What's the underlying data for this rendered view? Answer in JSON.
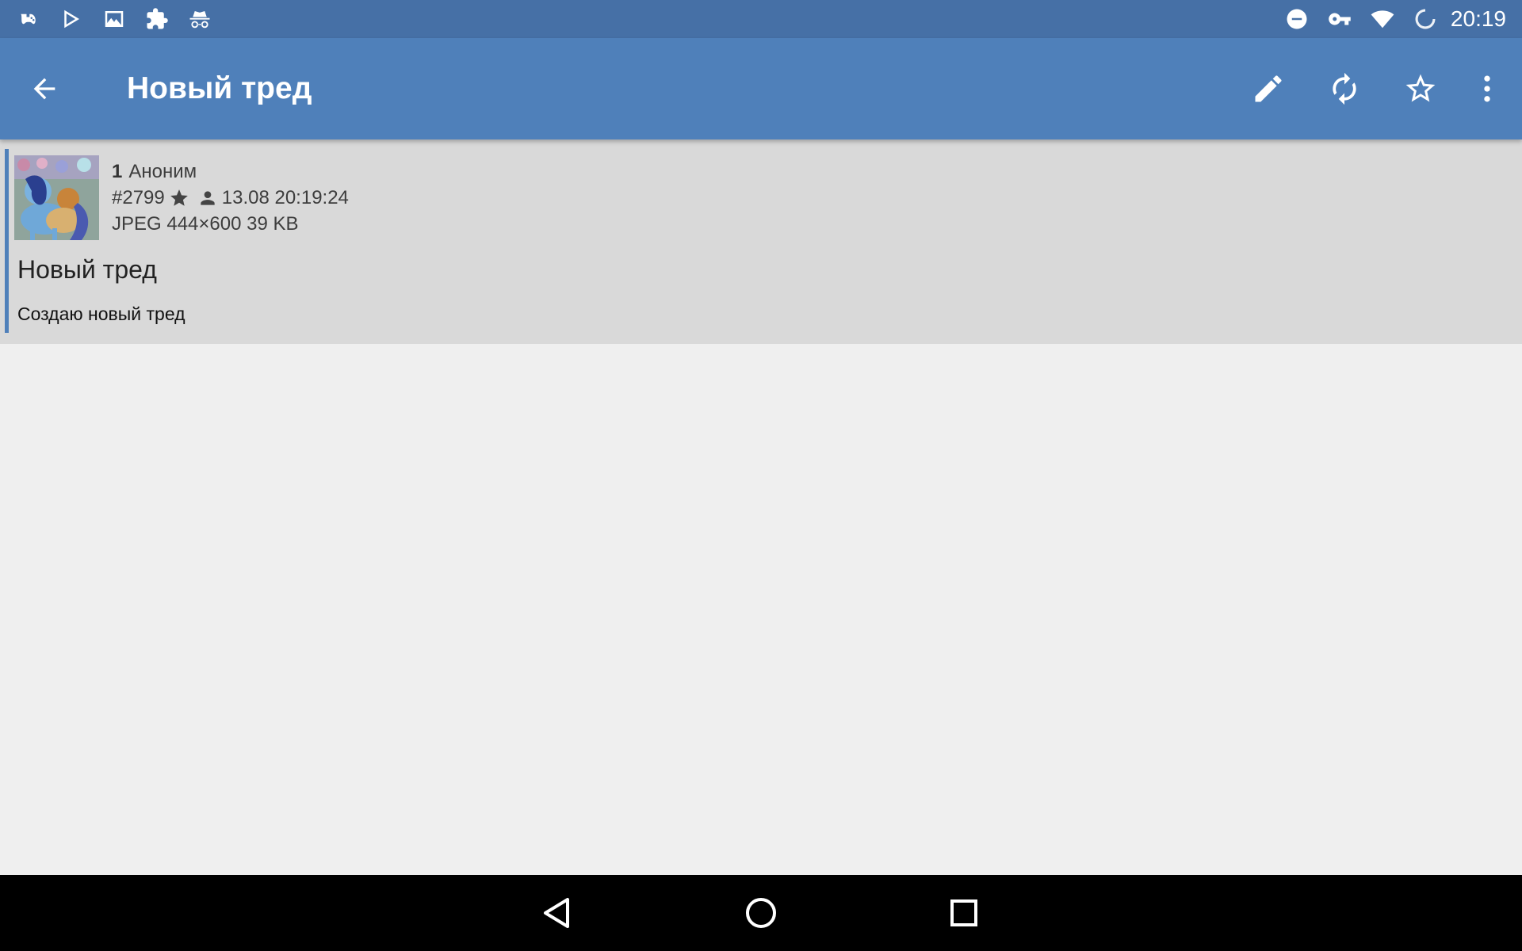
{
  "status_bar": {
    "time": "20:19",
    "left_icons": [
      "game-controller-icon",
      "play-store-icon",
      "image-icon",
      "puzzle-icon",
      "incognito-icon"
    ],
    "right_icons": [
      "do-not-disturb-icon",
      "vpn-key-icon",
      "wifi-icon",
      "loading-icon"
    ]
  },
  "app_bar": {
    "title": "Новый тред",
    "back_icon": "arrow-back-icon",
    "actions": [
      "edit-icon",
      "refresh-icon",
      "star-outline-icon",
      "more-vert-icon"
    ]
  },
  "post": {
    "number": "1",
    "author": "Аноним",
    "post_id": "#2799",
    "datetime": "13.08 20:19:24",
    "file_info": "JPEG 444×600 39 KB",
    "subject": "Новый тред",
    "body": "Создаю новый тред"
  },
  "colors": {
    "status_bar": "#4670a6",
    "app_bar": "#4f80ba",
    "post_background": "#d9d9d9",
    "page_background": "#efefef"
  }
}
